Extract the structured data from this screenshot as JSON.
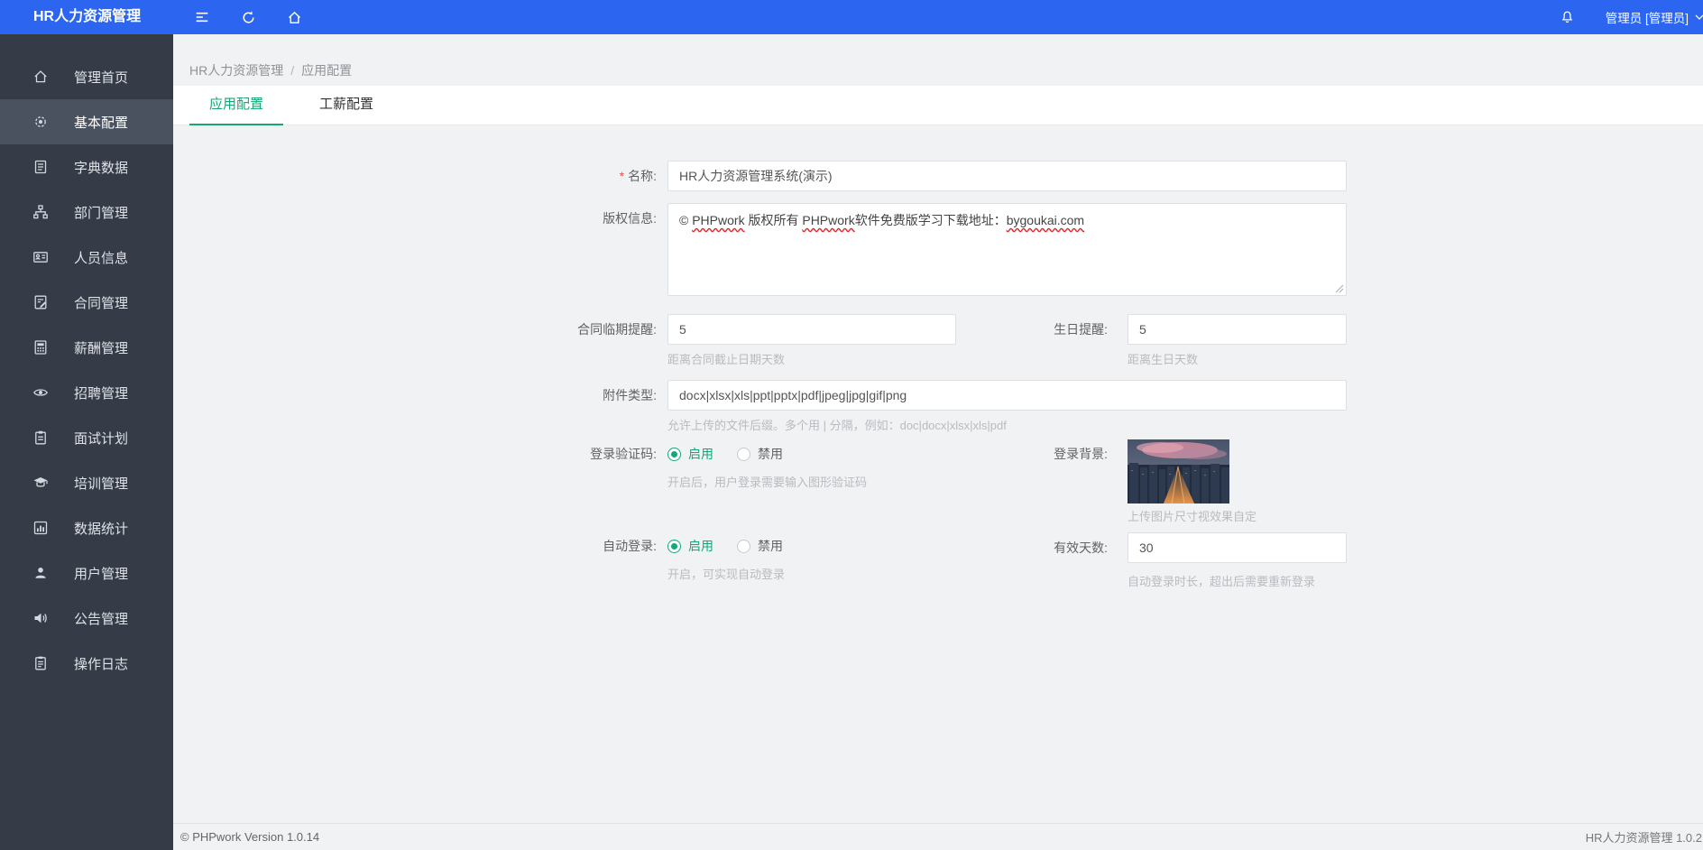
{
  "header": {
    "title": "HR人力资源管理",
    "user": "管理员 [管理员]"
  },
  "sidebar": {
    "items": [
      {
        "label": "管理首页",
        "icon": "home-icon",
        "active": false
      },
      {
        "label": "基本配置",
        "icon": "gear-icon",
        "active": true
      },
      {
        "label": "字典数据",
        "icon": "book-icon",
        "active": false
      },
      {
        "label": "部门管理",
        "icon": "sitemap-icon",
        "active": false
      },
      {
        "label": "人员信息",
        "icon": "id-card-icon",
        "active": false
      },
      {
        "label": "合同管理",
        "icon": "contract-icon",
        "active": false
      },
      {
        "label": "薪酬管理",
        "icon": "calculator-icon",
        "active": false
      },
      {
        "label": "招聘管理",
        "icon": "eye-icon",
        "active": false
      },
      {
        "label": "面试计划",
        "icon": "clipboard-icon",
        "active": false
      },
      {
        "label": "培训管理",
        "icon": "graduation-cap-icon",
        "active": false
      },
      {
        "label": "数据统计",
        "icon": "bar-chart-icon",
        "active": false
      },
      {
        "label": "用户管理",
        "icon": "user-icon",
        "active": false
      },
      {
        "label": "公告管理",
        "icon": "speaker-icon",
        "active": false
      },
      {
        "label": "操作日志",
        "icon": "log-icon",
        "active": false
      }
    ]
  },
  "breadcrumb": {
    "root": "HR人力资源管理",
    "separator": "/",
    "current": "应用配置"
  },
  "tabs": [
    {
      "label": "应用配置",
      "active": true
    },
    {
      "label": "工薪配置",
      "active": false
    }
  ],
  "form": {
    "name": {
      "required": "*",
      "label": "名称:",
      "value": "HR人力资源管理系统(演示)"
    },
    "copyright": {
      "label": "版权信息:",
      "segments": [
        {
          "text": "© "
        },
        {
          "text": "PHPwork",
          "misspelled": true
        },
        {
          "text": " 版权所有 "
        },
        {
          "text": "PHPwork",
          "misspelled": true
        },
        {
          "text": "软件免费版学习下载地址："
        },
        {
          "text": "bygoukai.com",
          "misspelled": true
        }
      ]
    },
    "contract_reminder": {
      "label": "合同临期提醒:",
      "value": "5",
      "hint": "距离合同截止日期天数"
    },
    "birthday_reminder": {
      "label": "生日提醒:",
      "value": "5",
      "hint": "距离生日天数"
    },
    "attachment_types": {
      "label": "附件类型:",
      "value": "docx|xlsx|xls|ppt|pptx|pdf|jpeg|jpg|gif|png",
      "hint": "允许上传的文件后缀。多个用 | 分隔，例如：doc|docx|xlsx|xls|pdf"
    },
    "login_captcha": {
      "label": "登录验证码:",
      "options": [
        "启用",
        "禁用"
      ],
      "selected": "启用",
      "hint": "开启后，用户登录需要输入图形验证码"
    },
    "login_background": {
      "label": "登录背景:",
      "hint": "上传图片尺寸视效果自定"
    },
    "auto_login": {
      "label": "自动登录:",
      "options": [
        "启用",
        "禁用"
      ],
      "selected": "启用",
      "hint": "开启，可实现自动登录"
    },
    "valid_days": {
      "label": "有效天数:",
      "value": "30",
      "hint": "自动登录时长，超出后需要重新登录"
    }
  },
  "footer": {
    "left": "© PHPwork Version 1.0.14",
    "right": "HR人力资源管理 1.0.2"
  },
  "colors": {
    "header_blue": "#2c66f0",
    "sidebar_bg": "#353c47",
    "sidebar_active_bg": "#4a5260",
    "accent_green": "#16a678",
    "content_bg": "#f1f2f3",
    "hint_gray": "#b8bbc0",
    "required_red": "#f04b4b"
  }
}
